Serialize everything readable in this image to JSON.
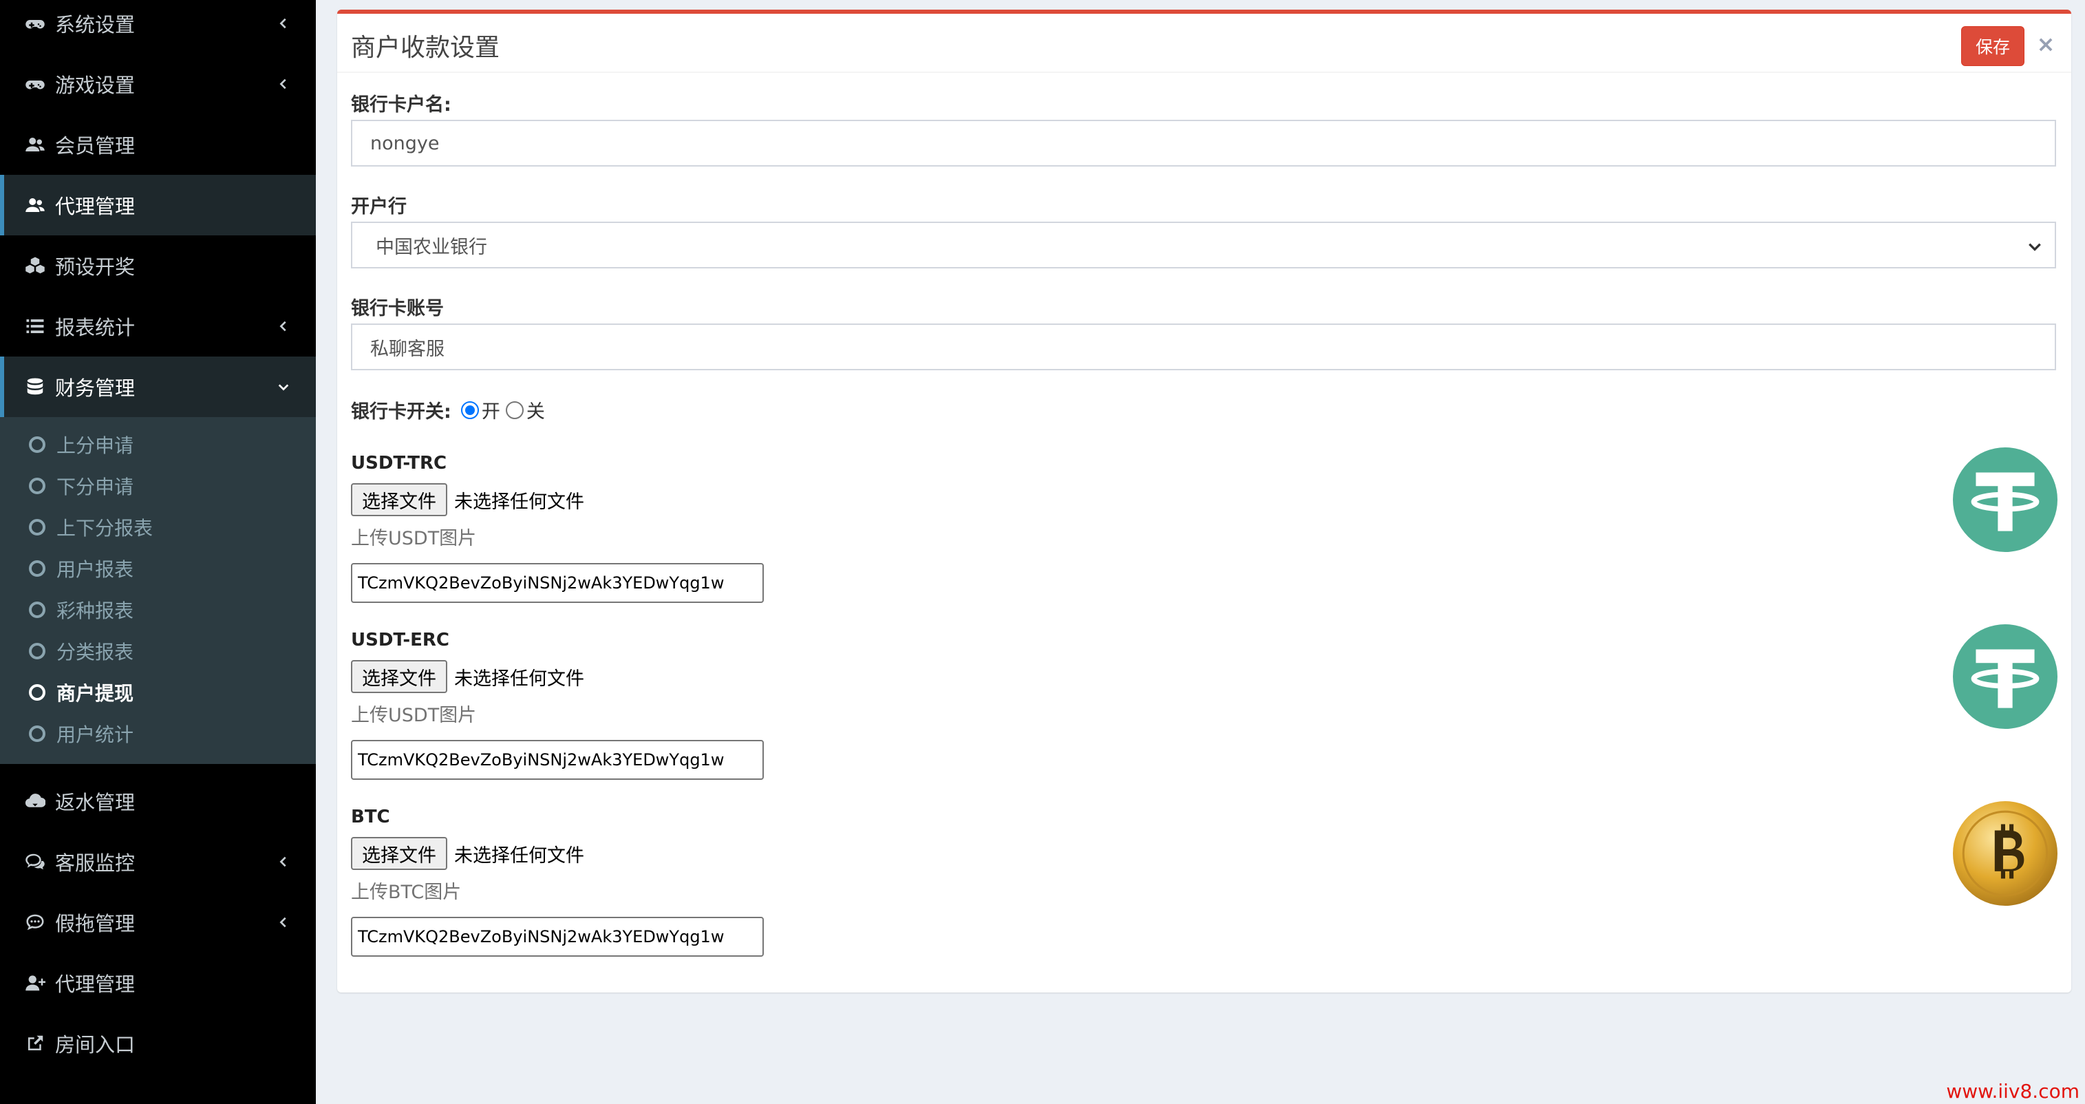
{
  "sidebar": {
    "items": [
      {
        "label": "系统设置",
        "icon": "gamepad-icon",
        "chevron": true
      },
      {
        "label": "游戏设置",
        "icon": "gamepad-icon",
        "chevron": true
      },
      {
        "label": "会员管理",
        "icon": "users-icon",
        "chevron": false
      },
      {
        "label": "代理管理",
        "icon": "users-icon",
        "chevron": false,
        "active": true
      },
      {
        "label": "预设开奖",
        "icon": "cubes-icon",
        "chevron": false
      },
      {
        "label": "报表统计",
        "icon": "list-icon",
        "chevron": true
      },
      {
        "label": "财务管理",
        "icon": "database-icon",
        "chevron": "down",
        "open": true
      }
    ],
    "submenu": [
      {
        "label": "上分申请"
      },
      {
        "label": "下分申请"
      },
      {
        "label": "上下分报表"
      },
      {
        "label": "用户报表"
      },
      {
        "label": "彩种报表"
      },
      {
        "label": "分类报表"
      },
      {
        "label": "商户提现",
        "active": true
      },
      {
        "label": "用户统计"
      }
    ],
    "items_bottom": [
      {
        "label": "返水管理",
        "icon": "cloud-download-icon",
        "chevron": false
      },
      {
        "label": "客服监控",
        "icon": "comments-icon",
        "chevron": true
      },
      {
        "label": "假拖管理",
        "icon": "comment-dots-icon",
        "chevron": true
      },
      {
        "label": "代理管理",
        "icon": "user-plus-icon",
        "chevron": false
      },
      {
        "label": "房间入口",
        "icon": "external-link-icon",
        "chevron": false
      }
    ]
  },
  "box": {
    "title": "商户收款设置",
    "save_label": "保存",
    "close_label": "×"
  },
  "form": {
    "account_name_label": "银行卡户名:",
    "account_name_value": "nongye",
    "bank_label": "开户行",
    "bank_value": "中国农业银行",
    "card_number_label": "银行卡账号",
    "card_number_value": "私聊客服",
    "switch_label": "银行卡开关:",
    "switch_on": "开",
    "switch_off": "关",
    "switch_selected": "开"
  },
  "coins": [
    {
      "label": "USDT-TRC",
      "file_button": "选择文件",
      "file_status": "未选择任何文件",
      "help": "上传USDT图片",
      "address": "TCzmVKQ2BevZoByiNSNj2wAk3YEDwYqg1w",
      "icon": "tether-icon",
      "color": "#50af95"
    },
    {
      "label": "USDT-ERC",
      "file_button": "选择文件",
      "file_status": "未选择任何文件",
      "help": "上传USDT图片",
      "address": "TCzmVKQ2BevZoByiNSNj2wAk3YEDwYqg1w",
      "icon": "tether-icon",
      "color": "#50af95"
    },
    {
      "label": "BTC",
      "file_button": "选择文件",
      "file_status": "未选择任何文件",
      "help": "上传BTC图片",
      "address": "TCzmVKQ2BevZoByiNSNj2wAk3YEDwYqg1w",
      "icon": "bitcoin-icon",
      "color": "#e8b33c"
    }
  ],
  "watermark": "www.iiv8.com",
  "colors": {
    "accent": "#3c8dbc",
    "danger": "#dd4b39",
    "sidebar_bg": "#000000",
    "submenu_bg": "#2c3b41"
  }
}
